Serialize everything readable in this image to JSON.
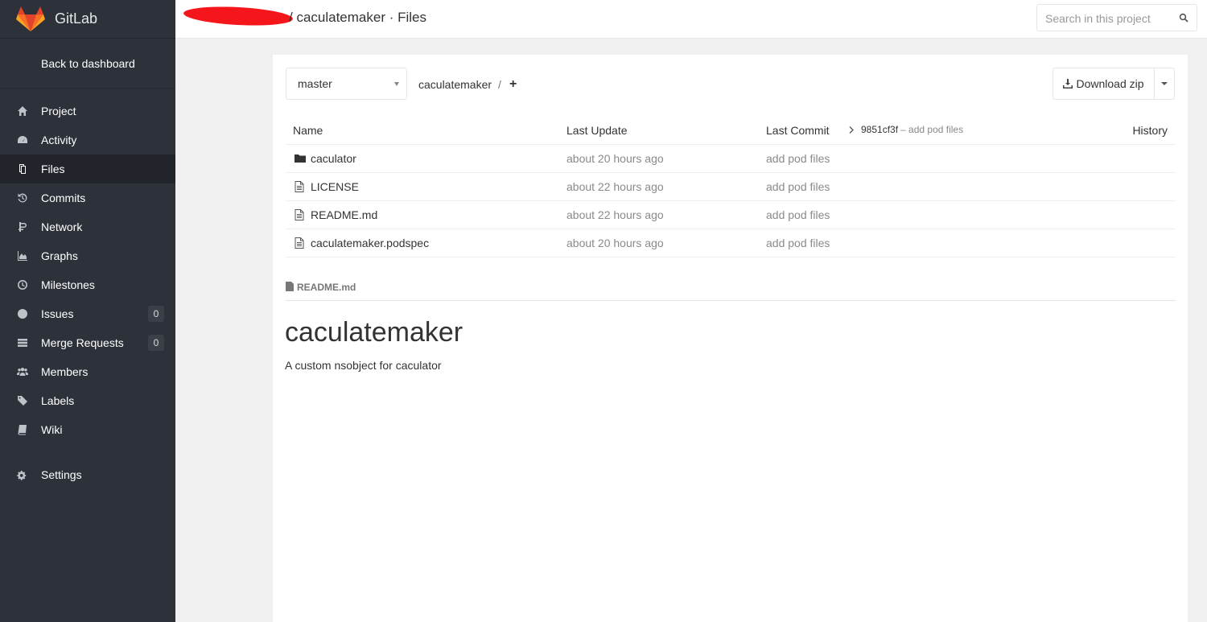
{
  "brand": {
    "name": "GitLab"
  },
  "sidebar": {
    "back_label": "Back to dashboard",
    "items": [
      {
        "label": "Project",
        "icon": "home-icon"
      },
      {
        "label": "Activity",
        "icon": "dashboard-icon"
      },
      {
        "label": "Files",
        "icon": "files-icon",
        "active": true
      },
      {
        "label": "Commits",
        "icon": "history-icon"
      },
      {
        "label": "Network",
        "icon": "network-icon"
      },
      {
        "label": "Graphs",
        "icon": "area-chart-icon"
      },
      {
        "label": "Milestones",
        "icon": "clock-icon"
      },
      {
        "label": "Issues",
        "icon": "exclamation-circle-icon",
        "badge": "0"
      },
      {
        "label": "Merge Requests",
        "icon": "list-icon",
        "badge": "0"
      },
      {
        "label": "Members",
        "icon": "users-icon"
      },
      {
        "label": "Labels",
        "icon": "tags-icon"
      },
      {
        "label": "Wiki",
        "icon": "book-icon"
      }
    ],
    "settings_label": "Settings"
  },
  "header": {
    "title": "/ caculatemaker · Files",
    "search_placeholder": "Search in this project"
  },
  "toolbar": {
    "branch": "master",
    "breadcrumb_repo": "caculatemaker",
    "breadcrumb_sep": "/",
    "add_symbol": "+",
    "download_label": "Download zip"
  },
  "table": {
    "headers": {
      "name": "Name",
      "last_update": "Last Update",
      "last_commit": "Last Commit",
      "history": "History"
    },
    "last_commit_sha": "9851cf3f",
    "last_commit_msg": "– add pod files",
    "rows": [
      {
        "name": "caculator",
        "type": "folder",
        "updated": "about 20 hours ago",
        "commit": "add pod files"
      },
      {
        "name": "LICENSE",
        "type": "file",
        "updated": "about 22 hours ago",
        "commit": "add pod files"
      },
      {
        "name": "README.md",
        "type": "file",
        "updated": "about 22 hours ago",
        "commit": "add pod files"
      },
      {
        "name": "caculatemaker.podspec",
        "type": "file",
        "updated": "about 20 hours ago",
        "commit": "add pod files"
      }
    ]
  },
  "readme": {
    "filename": "README.md",
    "title": "caculatemaker",
    "body": "A custom nsobject for caculator"
  },
  "colors": {
    "sidebar_bg": "#2c313a",
    "sidebar_active": "#21252b",
    "redaction": "#f5161c",
    "logo_orange": "#fc6d26"
  }
}
